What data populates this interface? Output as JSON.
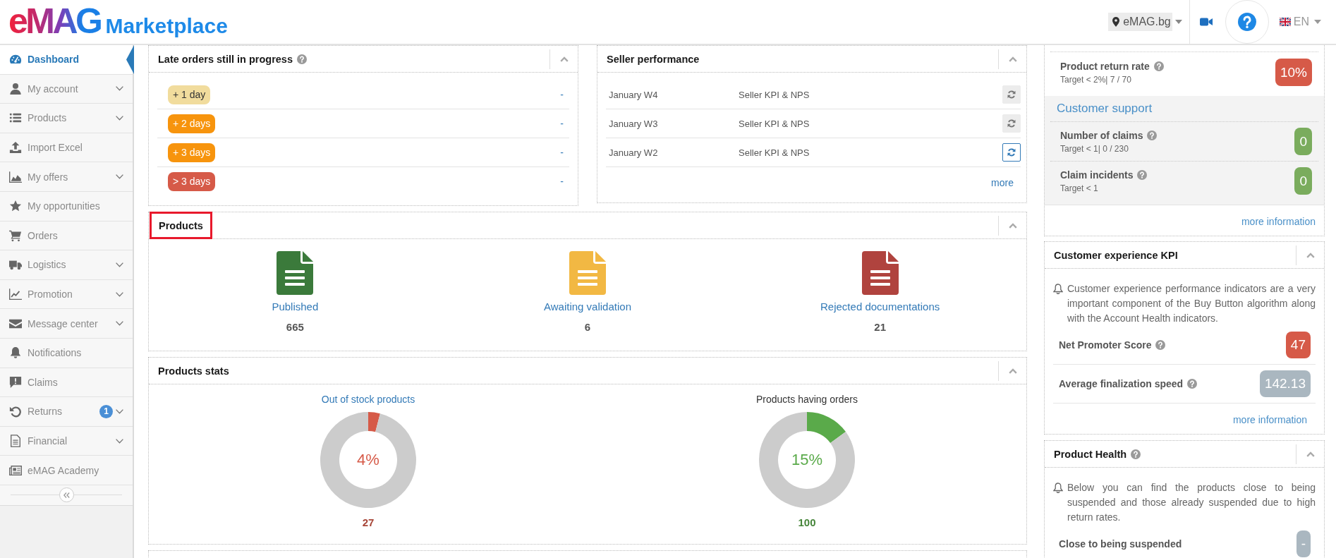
{
  "header": {
    "logo": {
      "brand": "eMAG",
      "product": "Marketplace"
    },
    "region": "eMAG.bg",
    "language": "EN"
  },
  "sidebar": {
    "items": [
      {
        "label": "Dashboard",
        "selected": true,
        "has_submenu": false
      },
      {
        "label": "My account",
        "selected": false,
        "has_submenu": true
      },
      {
        "label": "Products",
        "selected": false,
        "has_submenu": true
      },
      {
        "label": "Import Excel",
        "selected": false,
        "has_submenu": false
      },
      {
        "label": "My offers",
        "selected": false,
        "has_submenu": true
      },
      {
        "label": "My opportunities",
        "selected": false,
        "has_submenu": false
      },
      {
        "label": "Orders",
        "selected": false,
        "has_submenu": false
      },
      {
        "label": "Logistics",
        "selected": false,
        "has_submenu": true
      },
      {
        "label": "Promotion",
        "selected": false,
        "has_submenu": true
      },
      {
        "label": "Message center",
        "selected": false,
        "has_submenu": true
      },
      {
        "label": "Notifications",
        "selected": false,
        "has_submenu": false
      },
      {
        "label": "Claims",
        "selected": false,
        "has_submenu": false
      },
      {
        "label": "Returns",
        "selected": false,
        "has_submenu": true,
        "badge": "1"
      },
      {
        "label": "Financial",
        "selected": false,
        "has_submenu": true
      },
      {
        "label": "eMAG Academy",
        "selected": false,
        "has_submenu": false
      }
    ]
  },
  "late_orders": {
    "title": "Late orders still in progress",
    "help": true,
    "rows": [
      {
        "label": "+ 1 day",
        "color": "#f1dc9d",
        "count": "-"
      },
      {
        "label": "+ 2 days",
        "color": "#f7940d",
        "count": "-"
      },
      {
        "label": "+ 3 days",
        "color": "#f7940d",
        "count": "-"
      },
      {
        "label": "> 3 days",
        "color": "#d65a48",
        "count": "-"
      }
    ]
  },
  "seller_performance": {
    "title": "Seller performance",
    "rows": [
      {
        "period": "January W4",
        "report": "Seller KPI & NPS",
        "disabled": true
      },
      {
        "period": "January W3",
        "report": "Seller KPI & NPS",
        "disabled": true
      },
      {
        "period": "January W2",
        "report": "Seller KPI & NPS",
        "disabled": false
      }
    ],
    "more_link": "more"
  },
  "products": {
    "title": "Products",
    "title_marked": true,
    "items": [
      {
        "label": "Published",
        "count": "665",
        "color": "#3b7a3b"
      },
      {
        "label": "Awaiting validation",
        "count": "6",
        "color": "#f2b843"
      },
      {
        "label": "Rejected documentations",
        "count": "21",
        "color": "#b0433e"
      }
    ]
  },
  "products_stats": {
    "title": "Products stats",
    "items": [
      {
        "title": "Out of stock products",
        "link": true,
        "chart_data": {
          "type": "donut",
          "values": [
            4,
            96
          ]
        },
        "reading": "4%",
        "count": "27",
        "color": "#d65a48"
      },
      {
        "title": "Products having orders",
        "link": false,
        "chart_data": {
          "type": "donut",
          "values": [
            15,
            85
          ]
        },
        "reading": "15%",
        "count": "100",
        "color": "#5aaa4a"
      }
    ]
  },
  "account_health": {
    "metrics": [
      {
        "label": "Product return rate",
        "help": true,
        "target": "Target < 2%| 7 / 70",
        "value": "10%",
        "color": "#d65a48"
      }
    ],
    "sections": [
      {
        "title": "Customer support",
        "metrics": [
          {
            "label": "Number of claims",
            "help": true,
            "target": "Target < 1| 0 / 230",
            "value": "0",
            "color": "#7aac5d"
          },
          {
            "label": "Claim incidents",
            "help": true,
            "target": "Target < 1",
            "value": "0",
            "color": "#7aac5d"
          }
        ]
      }
    ],
    "more_link": "more information"
  },
  "customer_experience": {
    "title": "Customer experience KPI",
    "note": "Customer experience performance indicators are a very important component of the Buy Button algorithm along with the Account Health indicators.",
    "metrics": [
      {
        "label": "Net Promoter Score",
        "help": true,
        "value": "47",
        "color": "#d65a48"
      },
      {
        "label": "Average finalization speed",
        "help": true,
        "value": "142.13",
        "color": "#aab7c0"
      }
    ],
    "more_link": "more information"
  },
  "product_health": {
    "title": "Product Health",
    "help": true,
    "note": "Below you can find the products close to being suspended and those already suspended due to high return rates.",
    "metrics": [
      {
        "label": "Close to being suspended",
        "value": "-",
        "color": "#aab7c0"
      }
    ]
  }
}
